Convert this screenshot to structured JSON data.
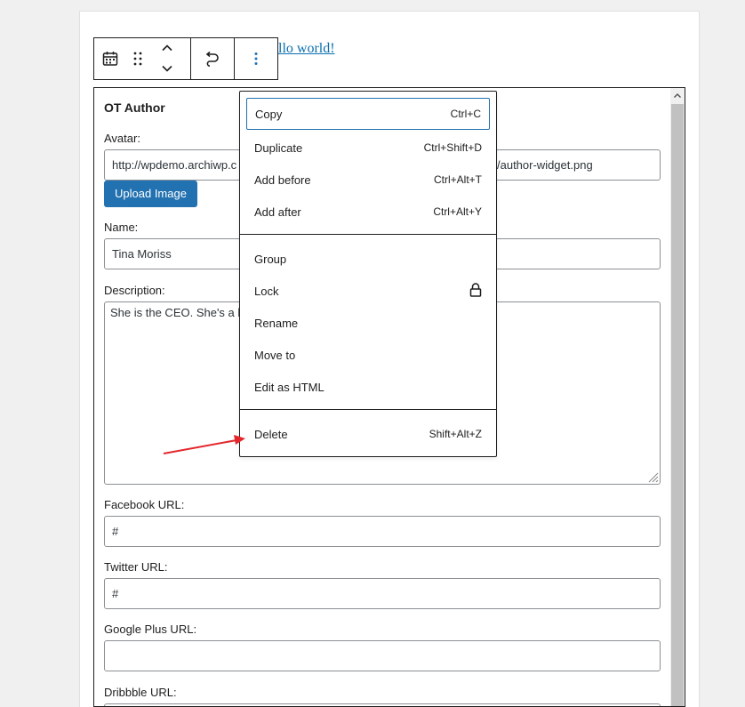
{
  "post": {
    "title_link": "llo world!"
  },
  "toolbar": {
    "icons": [
      "calendar-icon",
      "drag-handle-icon",
      "move-up-icon",
      "move-down-icon",
      "transform-icon",
      "options-icon"
    ]
  },
  "widget": {
    "title": "OT Author",
    "avatar_label": "Avatar:",
    "avatar_value_left": "http://wpdemo.archiwp.c",
    "avatar_value_right": "/author-widget.png",
    "upload_button": "Upload Image",
    "name_label": "Name:",
    "name_value": "Tina Moriss",
    "description_label": "Description:",
    "description_value": "She is the CEO. She's a l",
    "facebook_label": "Facebook URL:",
    "facebook_value": "#",
    "twitter_label": "Twitter URL:",
    "twitter_value": "#",
    "googleplus_label": "Google Plus URL:",
    "googleplus_value": "",
    "dribbble_label": "Dribbble URL:"
  },
  "menu": {
    "copy": {
      "label": "Copy",
      "shortcut": "Ctrl+C"
    },
    "duplicate": {
      "label": "Duplicate",
      "shortcut": "Ctrl+Shift+D"
    },
    "add_before": {
      "label": "Add before",
      "shortcut": "Ctrl+Alt+T"
    },
    "add_after": {
      "label": "Add after",
      "shortcut": "Ctrl+Alt+Y"
    },
    "group": {
      "label": "Group"
    },
    "lock": {
      "label": "Lock",
      "icon": "lock-icon"
    },
    "rename": {
      "label": "Rename"
    },
    "move_to": {
      "label": "Move to"
    },
    "edit_html": {
      "label": "Edit as HTML"
    },
    "delete": {
      "label": "Delete",
      "shortcut": "Shift+Alt+Z"
    }
  },
  "colors": {
    "accent": "#2271b1",
    "annotation_arrow": "#e3262b",
    "link": "#0a6fb0"
  }
}
